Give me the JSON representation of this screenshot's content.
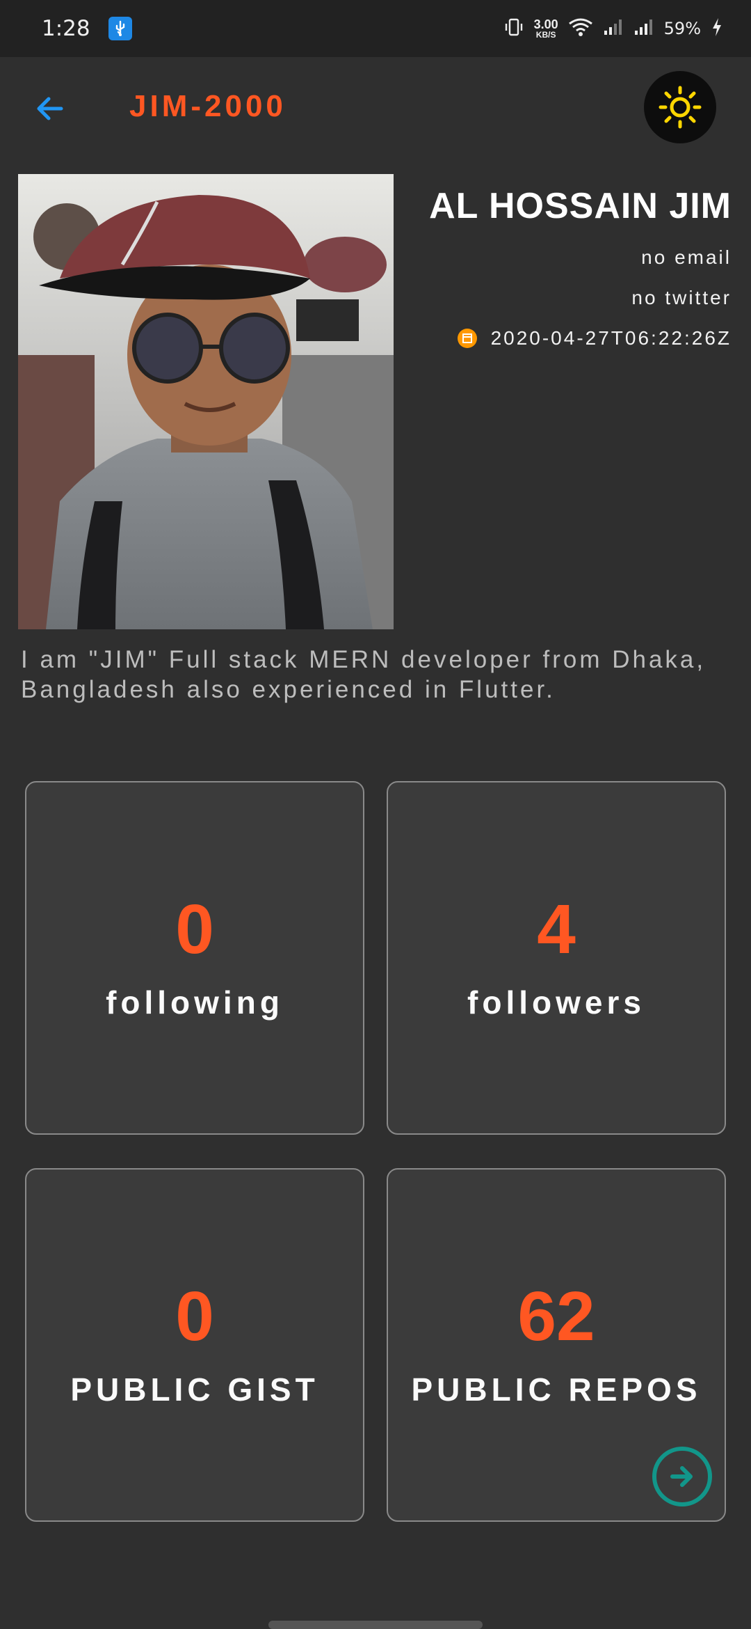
{
  "status_bar": {
    "time": "1:28",
    "net_speed_value": "3.00",
    "net_speed_unit": "KB/S",
    "battery": "59%"
  },
  "app_bar": {
    "title": "JIM-2000"
  },
  "profile": {
    "name": "AL HOSSAIN JIM",
    "email": "no email",
    "twitter": "no twitter",
    "created_at": "2020-04-27T06:22:26Z",
    "bio": "I am \"JIM\" Full stack MERN developer from Dhaka, Bangladesh also experienced in Flutter."
  },
  "stats": {
    "following": {
      "value": "0",
      "label": "following"
    },
    "followers": {
      "value": "4",
      "label": "followers"
    },
    "gists": {
      "value": "0",
      "label": "PUBLIC GIST"
    },
    "repos": {
      "value": "62",
      "label": "PUBLIC REPOS"
    }
  },
  "colors": {
    "accent": "#ff5722",
    "back_arrow": "#2196f3",
    "sun": "#ffd600",
    "go_button": "#12968a",
    "background": "#2f2f2f",
    "card": "#3b3b3b"
  }
}
